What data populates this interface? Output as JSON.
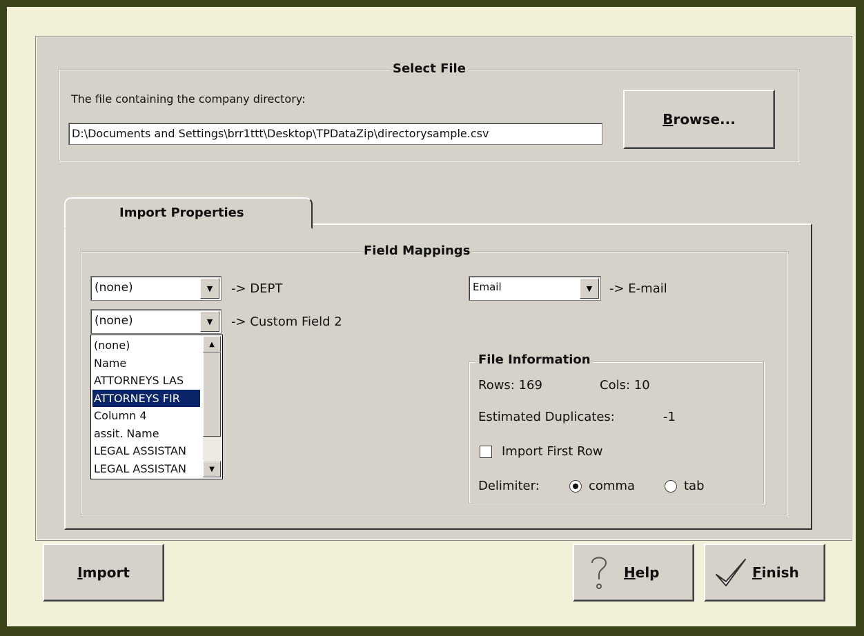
{
  "select_file": {
    "title": "Select File",
    "prompt": "The file containing the company directory:",
    "path": "D:\\Documents and Settings\\brr1ttt\\Desktop\\TPDataZip\\directorysample.csv",
    "browse_label_u": "B",
    "browse_label_rest": "rowse..."
  },
  "tab": {
    "label": "Import Properties"
  },
  "field_mappings": {
    "title": "Field Mappings",
    "mappings": [
      {
        "value": "(none)",
        "target": "-> DEPT"
      },
      {
        "value": "(none)",
        "target": "-> Custom Field 2"
      },
      {
        "value": "Email",
        "target": "-> E-mail"
      }
    ],
    "dropdown_options": [
      "(none)",
      "Name",
      "ATTORNEYS LAS",
      "ATTORNEYS FIR",
      "Column 4",
      "assit. Name",
      "LEGAL ASSISTAN",
      "LEGAL ASSISTAN"
    ],
    "selected_option_index": 3
  },
  "file_info": {
    "title": "File Information",
    "rows_label": "Rows: 169",
    "cols_label": "Cols: 10",
    "duplicates_label": "Estimated Duplicates:",
    "duplicates_value": "-1",
    "import_first_row_label": "Import First Row",
    "import_first_row_checked": false,
    "delimiter_label": "Delimiter:",
    "delimiter_options": [
      "comma",
      "tab"
    ],
    "delimiter_selected": "comma"
  },
  "buttons": {
    "import_u": "I",
    "import_rest": "mport",
    "help_u": "H",
    "help_rest": "elp",
    "finish_u": "F",
    "finish_rest": "inish"
  }
}
